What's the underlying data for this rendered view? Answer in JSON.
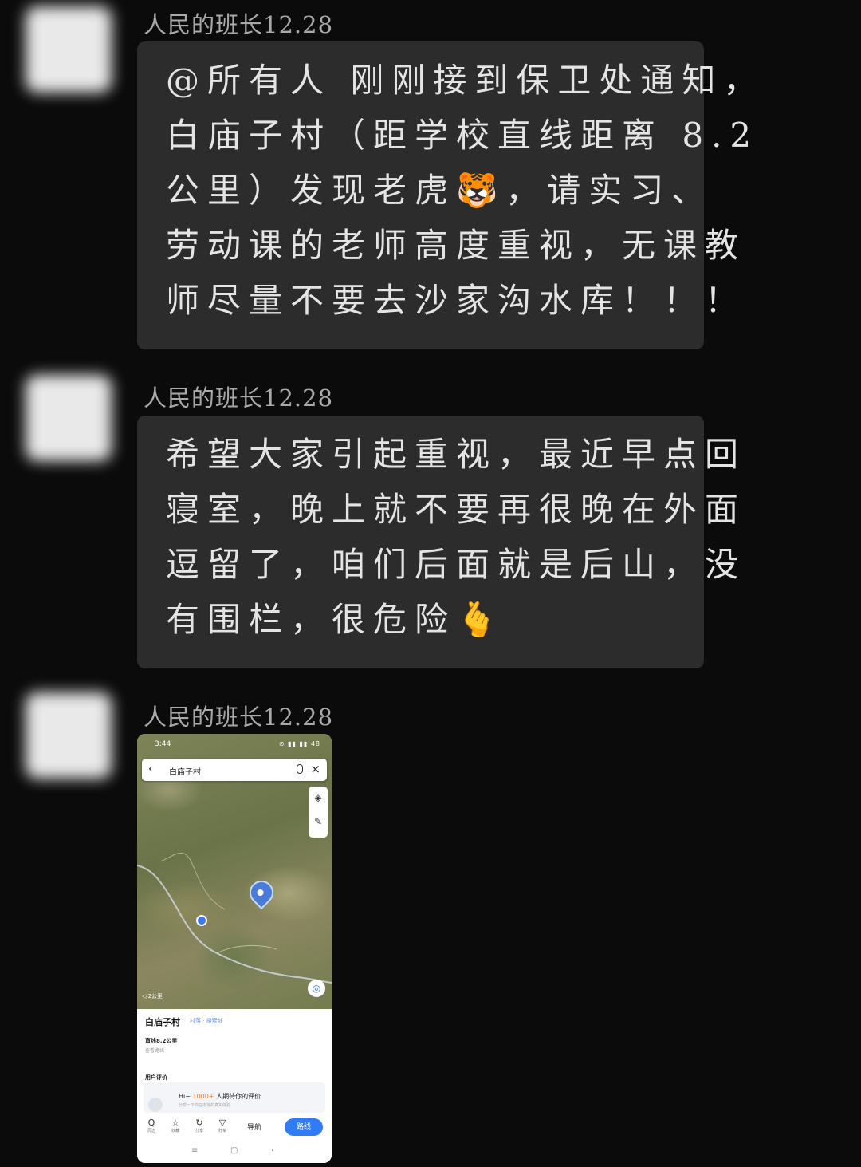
{
  "messages": [
    {
      "sender": "人民的班长12.28",
      "lines": [
        "@所有人  刚刚接到保卫处通知，",
        "白庙子村（距学校直线距离 8.2",
        "公里）发现老虎🐯，请实习、",
        "劳动课的老师高度重视，无课教",
        "师尽量不要去沙家沟水库！！！"
      ]
    },
    {
      "sender": "人民的班长12.28",
      "lines": [
        "希望大家引起重视，最近早点回",
        "寝室，晚上就不要再很晚在外面",
        "逗留了，咱们后面就是后山，没",
        "有围栏，很危险🫰"
      ]
    },
    {
      "sender": "人民的班长12.28",
      "image": {
        "status_time": "3:44",
        "status_icons": "⊙ ▮▮ ▮▮ 48",
        "search_text": "白庙子村",
        "place_name": "白庙子村",
        "place_tags": "村落  · 搜索址",
        "distance": "直线8.2公里",
        "distance_sub": "查看路线",
        "reviews_title": "用户评价",
        "review_prompt_prefix": "Hi~ ",
        "review_prompt_count": "1000+",
        "review_prompt_suffix": " 人期待你的评价",
        "review_sub": "分享一下你在本地的真实体验",
        "bottom_items": [
          {
            "icon": "Q",
            "label": "周边"
          },
          {
            "icon": "☆",
            "label": "收藏"
          },
          {
            "icon": "↻",
            "label": "分享"
          },
          {
            "icon": "▽",
            "label": "打车"
          }
        ],
        "nav_label": "导航",
        "route_label": "路线",
        "scale_label": "◁ 2公里",
        "sys_nav": [
          "≡",
          "▢",
          "‹"
        ]
      }
    }
  ]
}
